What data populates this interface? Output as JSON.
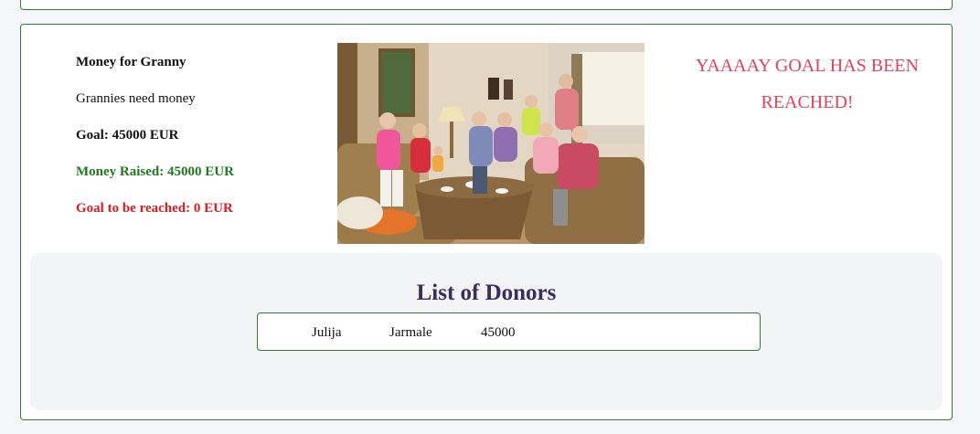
{
  "campaign": {
    "title": "Money for Granny",
    "description": "Grannies need money",
    "goal": "Goal: 45000 EUR",
    "raised": "Money Raised: 45000 EUR",
    "remaining": "Goal to be reached: 0 EUR",
    "goal_reached_message": "YAAAAY GOAL HAS BEEN REACHED!",
    "image_alt": "group-of-seniors-photo"
  },
  "donors": {
    "title": "List of Donors",
    "rows": [
      {
        "first_name": "Julija",
        "last_name": "Jarmale",
        "amount": "45000"
      }
    ]
  },
  "colors": {
    "card_border": "#2e7d32",
    "raised_text": "#1f7a1f",
    "remaining_text": "#e01b1b",
    "goal_message": "#e0435c",
    "donors_title": "#3b2d5c",
    "donors_bg": "#f3f4f6",
    "page_bg": "#f4f6f9"
  }
}
